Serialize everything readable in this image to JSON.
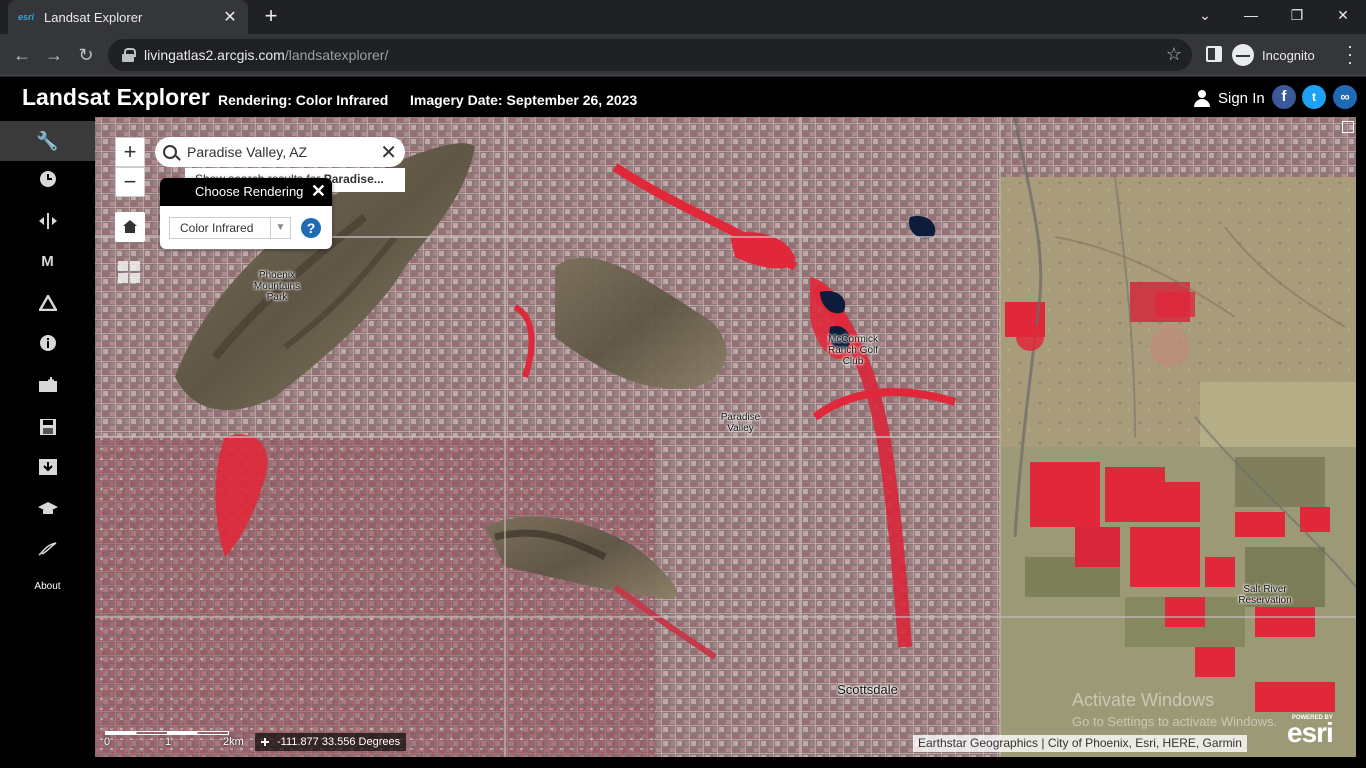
{
  "browser": {
    "tab_title": "Landsat Explorer",
    "tab_favicon": "esri",
    "url_host": "livingatlas2.arcgis.com",
    "url_path": "/landsatexplorer/",
    "profile_label": "Incognito"
  },
  "header": {
    "title": "Landsat Explorer",
    "rendering": "Rendering: Color Infrared",
    "imagery_date": "Imagery Date: September 26, 2023",
    "sign_in": "Sign In"
  },
  "sidebar": {
    "items": [
      "wrench-icon",
      "clock-icon",
      "swipe-icon",
      "m-icon",
      "triangle-icon",
      "info-icon",
      "bookmark-icon",
      "save-icon",
      "download-icon",
      "graduation-cap-icon",
      "story-icon"
    ],
    "about_label": "About"
  },
  "map": {
    "search_value": "Paradise Valley, AZ",
    "suggestion_prefix": "Show search results for ",
    "suggestion_bold": "Paradise...",
    "render_panel_title": "Choose Rendering",
    "render_select_value": "Color Infrared",
    "places": {
      "phoenix_mountains": "Phoenix Mountains Park",
      "mccormick": "McCormick Ranch Golf Club",
      "paradise_valley": "Paradise Valley",
      "salt_river": "Salt River Reservation",
      "scottsdale": "Scottsdale"
    },
    "scale_labels": [
      "0",
      "1",
      "2km"
    ],
    "coordinates": "-111.877 33.556 Degrees",
    "attribution": "Earthstar Geographics | City of Phoenix, Esri, HERE, Garmin",
    "esri_powered": "POWERED BY",
    "esri_logo": "esri",
    "watermark_title": "Activate Windows",
    "watermark_sub": "Go to Settings to activate Windows."
  },
  "colors": {
    "infrared_red": "#e0283a",
    "urban_base": "#8e7b78",
    "desert": "#a89a78",
    "facebook": "#3b5998",
    "twitter": "#1da1f2",
    "link": "#1f6ab5"
  }
}
